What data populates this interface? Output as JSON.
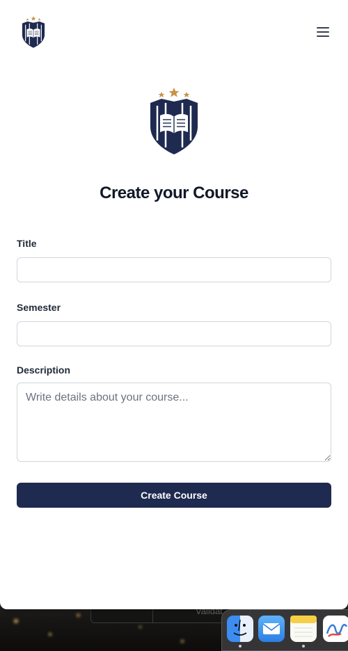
{
  "app": {
    "logo_alt": "university-crest-logo",
    "menu_icon": "hamburger-menu-icon"
  },
  "form": {
    "title": "Create your Course",
    "fields": {
      "title_label": "Title",
      "title_value": "",
      "semester_label": "Semester",
      "semester_value": "",
      "description_label": "Description",
      "description_placeholder": "Write details about your course..."
    },
    "submit_label": "Create Course"
  },
  "background": {
    "partial_window_text": "Validat"
  },
  "dock": {
    "items": [
      {
        "name": "finder-icon"
      },
      {
        "name": "mail-icon"
      },
      {
        "name": "notes-icon"
      },
      {
        "name": "freeform-icon"
      }
    ]
  },
  "colors": {
    "brand_navy": "#1e2a4f",
    "crest_gold": "#c8934a",
    "text_dark": "#111827",
    "border": "#d1d5db"
  }
}
